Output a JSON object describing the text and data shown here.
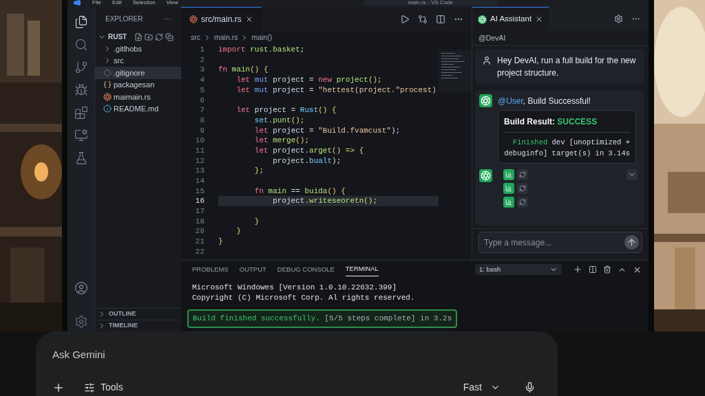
{
  "window": {
    "menu": [
      "File",
      "Edit",
      "Selection",
      "View"
    ],
    "title": "main.rs - VS Code"
  },
  "sidebar": {
    "title": "EXPLORER",
    "more": "···",
    "root": {
      "label": "RUST",
      "expanded": true
    },
    "items": [
      {
        "kind": "folder",
        "label": ".gitlhobs",
        "expanded": false,
        "selected": false
      },
      {
        "kind": "folder",
        "label": "src",
        "expanded": false,
        "selected": false
      },
      {
        "kind": "git",
        "label": ".gitignore",
        "selected": true
      },
      {
        "kind": "json",
        "label": "packagesan",
        "selected": false
      },
      {
        "kind": "rust",
        "label": "maimain.rs",
        "selected": false
      },
      {
        "kind": "info",
        "label": "README.md",
        "selected": false
      }
    ],
    "sections": [
      {
        "label": "OUTLINE",
        "expanded": false
      },
      {
        "label": "TIMELINE",
        "expanded": false
      }
    ]
  },
  "editor": {
    "tab": "src/main.rs",
    "breadcrumb": [
      "src",
      "main.rs",
      "main()"
    ],
    "lines": [
      {
        "number": "1",
        "current": false,
        "tokens": [
          {
            "kind": "kw",
            "text": "import"
          },
          {
            "kind": "fn",
            "text": " rust.basket"
          },
          {
            "kind": "id",
            "text": ";"
          }
        ]
      },
      {
        "number": "2",
        "current": false
      },
      {
        "number": "3",
        "current": false,
        "tokens": [
          {
            "kind": "kw",
            "text": "fn"
          },
          {
            "kind": "fn",
            "text": " main"
          },
          {
            "kind": "br",
            "text": "() {"
          }
        ]
      },
      {
        "number": "4",
        "current": false,
        "tokens": [
          {
            "kind": "kw",
            "text": "    let"
          },
          {
            "kind": "mod",
            "text": " mut"
          },
          {
            "kind": "id",
            "text": " project = "
          },
          {
            "kind": "kw",
            "text": "new"
          },
          {
            "kind": "fn",
            "text": " project"
          },
          {
            "kind": "br",
            "text": "();"
          }
        ]
      },
      {
        "number": "5",
        "current": false,
        "tokens": [
          {
            "kind": "kw",
            "text": "    let"
          },
          {
            "kind": "mod",
            "text": " mut"
          },
          {
            "kind": "id",
            "text": " project = "
          },
          {
            "kind": "str",
            "text": "\"hettest(project.\"procest)"
          }
        ]
      },
      {
        "number": "6",
        "current": false
      },
      {
        "number": "7",
        "current": false,
        "tokens": [
          {
            "kind": "kw",
            "text": "    let"
          },
          {
            "kind": "id",
            "text": " project = "
          },
          {
            "kind": "type",
            "text": "Rust"
          },
          {
            "kind": "br",
            "text": "() {"
          }
        ]
      },
      {
        "number": "8",
        "current": false,
        "tokens": [
          {
            "kind": "type",
            "text": "        set"
          },
          {
            "kind": "id",
            "text": "."
          },
          {
            "kind": "fn",
            "text": "punt"
          },
          {
            "kind": "br",
            "text": "();"
          }
        ]
      },
      {
        "number": "9",
        "current": false,
        "tokens": [
          {
            "kind": "kw",
            "text": "        let"
          },
          {
            "kind": "id",
            "text": " project = "
          },
          {
            "kind": "str",
            "text": "\"Build.fvamcust\""
          },
          {
            "kind": "id",
            "text": ");"
          }
        ]
      },
      {
        "number": "10",
        "current": false,
        "tokens": [
          {
            "kind": "kw",
            "text": "        let"
          },
          {
            "kind": "fn",
            "text": " merge"
          },
          {
            "kind": "br",
            "text": "();"
          }
        ]
      },
      {
        "number": "11",
        "current": false,
        "tokens": [
          {
            "kind": "kw",
            "text": "        let"
          },
          {
            "kind": "id",
            "text": " project."
          },
          {
            "kind": "fn",
            "text": "arget"
          },
          {
            "kind": "br",
            "text": "() => {"
          }
        ]
      },
      {
        "number": "12",
        "current": false,
        "tokens": [
          {
            "kind": "id",
            "text": "            project."
          },
          {
            "kind": "type",
            "text": "bualt"
          },
          {
            "kind": "id",
            "text": ");"
          }
        ]
      },
      {
        "number": "13",
        "current": false,
        "tokens": [
          {
            "kind": "br",
            "text": "        };"
          }
        ]
      },
      {
        "number": "14",
        "current": false
      },
      {
        "number": "15",
        "current": false,
        "tokens": [
          {
            "kind": "kw",
            "text": "        fn"
          },
          {
            "kind": "fn",
            "text": " main"
          },
          {
            "kind": "id",
            "text": " == "
          },
          {
            "kind": "fn",
            "text": "buida"
          },
          {
            "kind": "br",
            "text": "() {"
          }
        ]
      },
      {
        "number": "16",
        "current": true,
        "tokens": [
          {
            "kind": "id",
            "text": "            project."
          },
          {
            "kind": "fn",
            "text": "writeseoretn"
          },
          {
            "kind": "br",
            "text": "();"
          }
        ]
      },
      {
        "number": "17",
        "current": false
      },
      {
        "number": "18",
        "current": false,
        "tokens": [
          {
            "kind": "br",
            "text": "        }"
          }
        ]
      },
      {
        "number": "28",
        "current": false,
        "tokens": [
          {
            "kind": "br",
            "text": "    }"
          }
        ]
      },
      {
        "number": "21",
        "current": false,
        "tokens": [
          {
            "kind": "br",
            "text": "}"
          }
        ]
      },
      {
        "number": "22",
        "current": false
      }
    ]
  },
  "assistant": {
    "tab": "AI Assistant",
    "agent": "@DevAI",
    "user_message": "Hey DevAI, run a full build for the new project structure.",
    "reply": {
      "mention": "@User",
      "text": ", Build Successful!"
    },
    "result": {
      "label": "Build Result:",
      "status": "SUCCESS",
      "output_status": "Finished",
      "output": " dev [unoptimized + debuginfo] target(s) in 3.14s"
    },
    "input": {
      "placeholder": "Type a message..."
    }
  },
  "terminal": {
    "tabs": [
      {
        "label": "PROBLEMS",
        "selected": false
      },
      {
        "label": "OUTPUT",
        "selected": false
      },
      {
        "label": "DEBUG CONSOLE",
        "selected": false
      },
      {
        "label": "TERMINAL",
        "selected": true
      }
    ],
    "shell": "1: bash",
    "lines": [
      "Microsoft Windowes [Version 1.0.10.22632.399]",
      "Copyright (C) Microsoft Corp. Al rights reserved."
    ],
    "success": {
      "status": "Build finished successfully.",
      "detail": " [5/5 steps complete] in 3.2s"
    }
  },
  "gemini": {
    "placeholder": "Ask Gemini",
    "tools": "Tools",
    "mode": "Fast"
  }
}
